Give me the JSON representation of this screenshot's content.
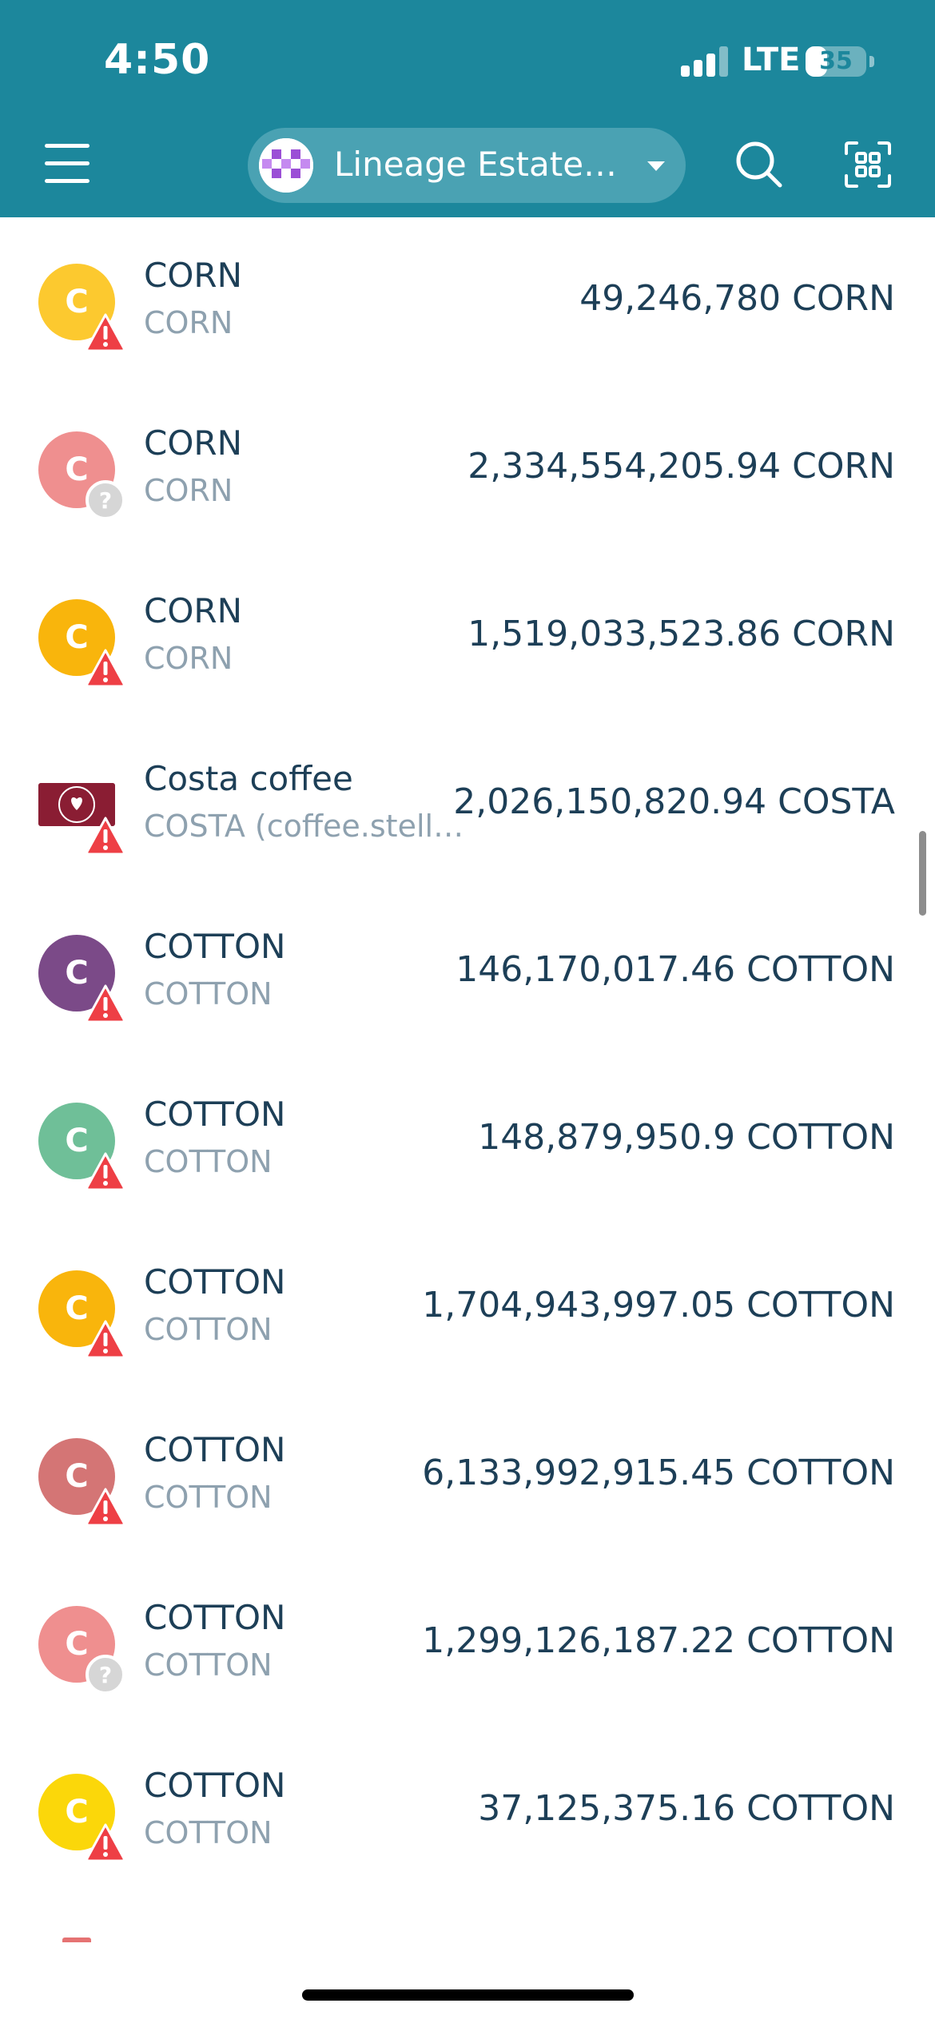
{
  "status_bar": {
    "time": "4:50",
    "network": "LTE",
    "battery": "35",
    "battery_level": 0.35
  },
  "header": {
    "wallet_name": "Lineage Estate…"
  },
  "tokens": [
    {
      "name": "CORN",
      "symbol": "CORN",
      "balance": "49,246,780 CORN",
      "icon_letter": "C",
      "icon_color": "#fcc92f",
      "badge": "warning"
    },
    {
      "name": "CORN",
      "symbol": "CORN",
      "balance": "2,334,554,205.94 CORN",
      "icon_letter": "C",
      "icon_color": "#ef8f8f",
      "badge": "unknown"
    },
    {
      "name": "CORN",
      "symbol": "CORN",
      "balance": "1,519,033,523.86 CORN",
      "icon_letter": "C",
      "icon_color": "#f9b50c",
      "badge": "warning"
    },
    {
      "name": "Costa coffee",
      "symbol": "COSTA (coffee.stella…",
      "balance": "2,026,150,820.94 COSTA",
      "icon_letter": "",
      "icon_color": "#8a1d33",
      "badge": "warning"
    },
    {
      "name": "COTTON",
      "symbol": "COTTON",
      "balance": "146,170,017.46 COTTON",
      "icon_letter": "C",
      "icon_color": "#7b4a88",
      "badge": "warning"
    },
    {
      "name": "COTTON",
      "symbol": "COTTON",
      "balance": "148,879,950.9 COTTON",
      "icon_letter": "C",
      "icon_color": "#6fbf98",
      "badge": "warning"
    },
    {
      "name": "COTTON",
      "symbol": "COTTON",
      "balance": "1,704,943,997.05 COTTON",
      "icon_letter": "C",
      "icon_color": "#f9b50c",
      "badge": "warning"
    },
    {
      "name": "COTTON",
      "symbol": "COTTON",
      "balance": "6,133,992,915.45 COTTON",
      "icon_letter": "C",
      "icon_color": "#d47575",
      "badge": "warning"
    },
    {
      "name": "COTTON",
      "symbol": "COTTON",
      "balance": "1,299,126,187.22 COTTON",
      "icon_letter": "C",
      "icon_color": "#ef8f8f",
      "badge": "unknown"
    },
    {
      "name": "COTTON",
      "symbol": "COTTON",
      "balance": "37,125,375.16 COTTON",
      "icon_letter": "C",
      "icon_color": "#fbd70a",
      "badge": "warning"
    }
  ]
}
